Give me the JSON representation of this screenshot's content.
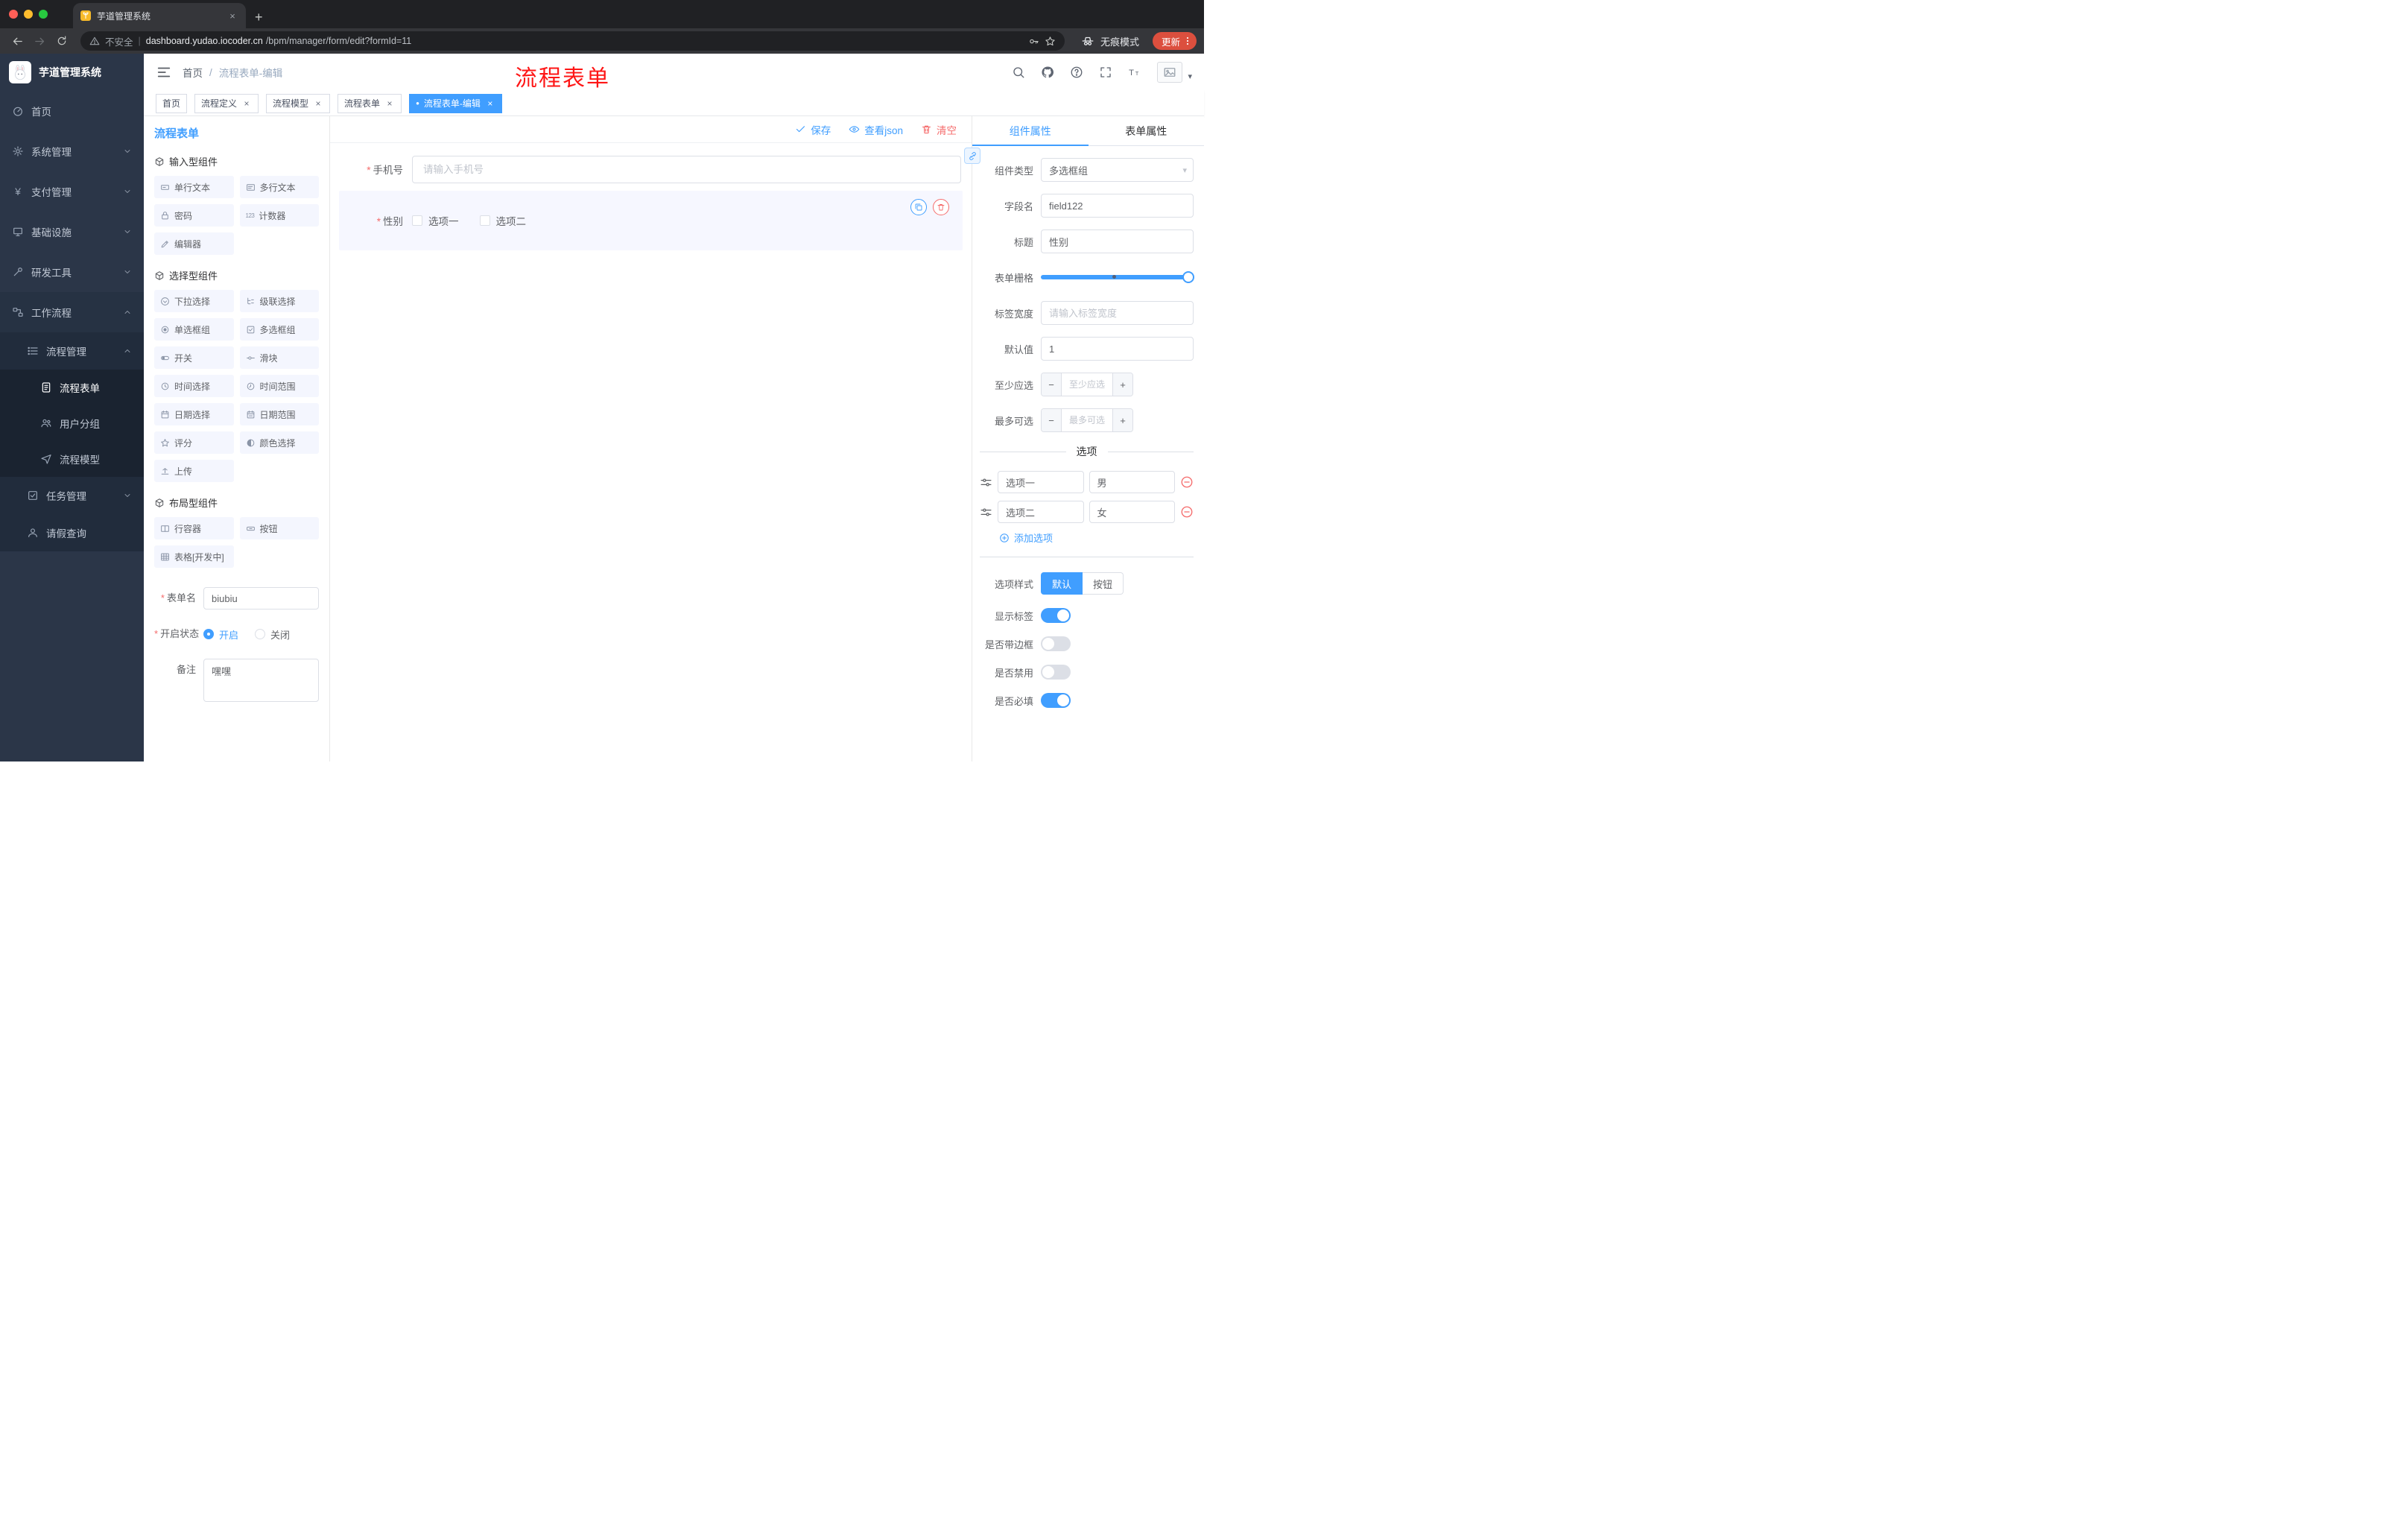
{
  "colors": {
    "accent": "#409eff",
    "danger": "#f56c6c",
    "update_pill": "#dc4f3e",
    "annotation_red": "#fe1616",
    "sidebar_bg": "#2b3648",
    "tag_active": "#409eff"
  },
  "icons": {
    "close": "×",
    "new_tab": "+",
    "caret_down": "▾",
    "breadcrumb_sep": "/",
    "security_divider": "|",
    "required_mark": "*",
    "tag_dot": "●",
    "counter": "123",
    "yen": "¥",
    "minus": "−",
    "plus": "+"
  },
  "browser": {
    "tab_title": "芋道管理系统",
    "security_label": "不安全",
    "url_host": "dashboard.yudao.iocoder.cn",
    "url_path": "/bpm/manager/form/edit?formId=11",
    "incognito_label": "无痕模式",
    "update_label": "更新"
  },
  "sidebar": {
    "logo_title": "芋道管理系统",
    "items": [
      {
        "label": "首页"
      },
      {
        "label": "系统管理"
      },
      {
        "label": "支付管理"
      },
      {
        "label": "基础设施"
      },
      {
        "label": "研发工具"
      },
      {
        "label": "工作流程"
      },
      {
        "label": "流程管理"
      },
      {
        "label": "流程表单"
      },
      {
        "label": "用户分组"
      },
      {
        "label": "流程模型"
      },
      {
        "label": "任务管理"
      },
      {
        "label": "请假查询"
      }
    ]
  },
  "navbar": {
    "breadcrumb_home": "首页",
    "breadcrumb_current": "流程表单-编辑",
    "annotation": "流程表单"
  },
  "tags": [
    {
      "label": "首页"
    },
    {
      "label": "流程定义"
    },
    {
      "label": "流程模型"
    },
    {
      "label": "流程表单"
    },
    {
      "label": "流程表单-编辑"
    }
  ],
  "palette": {
    "title": "流程表单",
    "groups": [
      {
        "title": "输入型组件",
        "items": [
          "单行文本",
          "多行文本",
          "密码",
          "计数器",
          "编辑器"
        ]
      },
      {
        "title": "选择型组件",
        "items": [
          "下拉选择",
          "级联选择",
          "单选框组",
          "多选框组",
          "开关",
          "滑块",
          "时间选择",
          "时间范围",
          "日期选择",
          "日期范围",
          "评分",
          "颜色选择",
          "上传"
        ]
      },
      {
        "title": "布局型组件",
        "items": [
          "行容器",
          "按钮",
          "表格[开发中]"
        ]
      }
    ],
    "form": {
      "name_label": "表单名",
      "name_value": "biubiu",
      "status_label": "开启状态",
      "status_on": "开启",
      "status_off": "关闭",
      "remark_label": "备注",
      "remark_value": "嘿嘿"
    }
  },
  "canvas": {
    "save": "保存",
    "view_json": "查看json",
    "clear": "清空",
    "phone": {
      "label": "手机号",
      "placeholder": "请输入手机号"
    },
    "gender": {
      "label": "性别",
      "option1": "选项一",
      "option2": "选项二"
    }
  },
  "properties": {
    "tab_component": "组件属性",
    "tab_form": "表单属性",
    "component_type": {
      "label": "组件类型",
      "value": "多选框组"
    },
    "field_name": {
      "label": "字段名",
      "value": "field122"
    },
    "title": {
      "label": "标题",
      "value": "性别"
    },
    "grid": {
      "label": "表单栅格"
    },
    "label_width": {
      "label": "标签宽度",
      "placeholder": "请输入标签宽度"
    },
    "default_value": {
      "label": "默认值",
      "value": "1"
    },
    "min_select": {
      "label": "至少应选",
      "placeholder": "至少应选"
    },
    "max_select": {
      "label": "最多可选",
      "placeholder": "最多可选"
    },
    "options": {
      "title": "选项",
      "row1_label": "选项一",
      "row1_value": "男",
      "row2_label": "选项二",
      "row2_value": "女",
      "add": "添加选项"
    },
    "style": {
      "label": "选项样式",
      "default": "默认",
      "button": "按钮"
    },
    "toggles": [
      {
        "label": "显示标签",
        "state": "on"
      },
      {
        "label": "是否带边框",
        "state": "off"
      },
      {
        "label": "是否禁用",
        "state": "off"
      },
      {
        "label": "是否必填",
        "state": "on"
      }
    ]
  }
}
